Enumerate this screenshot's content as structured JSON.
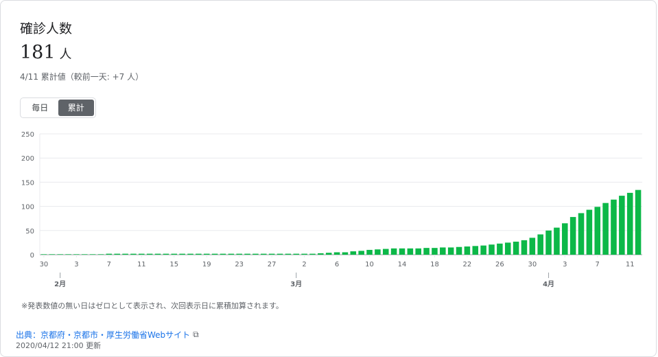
{
  "header": {
    "title": "確診人数",
    "total_value": "181",
    "total_unit": "人",
    "subtitle": "4/11 累計値（較前一天: +7 人）"
  },
  "toggle": {
    "daily_label": "毎日",
    "cumulative_label": "累計",
    "selected": "累計"
  },
  "colors": {
    "bar": "#0cb848",
    "grid": "#e8eaed",
    "axis": "#9aa0a6"
  },
  "chart_data": {
    "type": "bar",
    "title": "",
    "xlabel": "",
    "ylabel": "",
    "ylim": [
      0,
      250
    ],
    "yticks": [
      0,
      50,
      100,
      150,
      200,
      250
    ],
    "grid": true,
    "x_tick_labels": [
      "30",
      "3",
      "7",
      "11",
      "15",
      "19",
      "23",
      "27",
      "2",
      "6",
      "10",
      "14",
      "18",
      "22",
      "26",
      "30",
      "3",
      "7",
      "11"
    ],
    "month_labels": [
      "2月",
      "3月",
      "4月"
    ],
    "categories": [
      "1/30",
      "1/31",
      "2/1",
      "2/2",
      "2/3",
      "2/4",
      "2/5",
      "2/6",
      "2/7",
      "2/8",
      "2/9",
      "2/10",
      "2/11",
      "2/12",
      "2/13",
      "2/14",
      "2/15",
      "2/16",
      "2/17",
      "2/18",
      "2/19",
      "2/20",
      "2/21",
      "2/22",
      "2/23",
      "2/24",
      "2/25",
      "2/26",
      "2/27",
      "2/28",
      "2/29",
      "3/1",
      "3/2",
      "3/3",
      "3/4",
      "3/5",
      "3/6",
      "3/7",
      "3/8",
      "3/9",
      "3/10",
      "3/11",
      "3/12",
      "3/13",
      "3/14",
      "3/15",
      "3/16",
      "3/17",
      "3/18",
      "3/19",
      "3/20",
      "3/21",
      "3/22",
      "3/23",
      "3/24",
      "3/25",
      "3/26",
      "3/27",
      "3/28",
      "3/29",
      "3/30",
      "3/31",
      "4/1",
      "4/2",
      "4/3",
      "4/4",
      "4/5",
      "4/6",
      "4/7",
      "4/8",
      "4/9",
      "4/10",
      "4/11"
    ],
    "values": [
      1,
      1,
      1,
      1,
      1,
      1,
      1,
      1,
      2,
      2,
      2,
      2,
      2,
      2,
      2,
      2,
      2,
      2,
      2,
      2,
      2,
      2,
      2,
      2,
      2,
      2,
      2,
      2,
      2,
      2,
      2,
      2,
      2,
      2,
      3,
      4,
      5,
      5,
      7,
      8,
      10,
      11,
      12,
      13,
      13,
      13,
      13,
      14,
      14,
      15,
      15,
      16,
      17,
      18,
      19,
      21,
      23,
      25,
      27,
      30,
      35,
      42,
      50,
      56,
      65,
      78,
      86,
      93,
      99,
      107,
      114,
      122,
      128,
      134
    ]
  },
  "footer": {
    "note": "※発表数値の無い日はゼロとして表示され、次回表示日に累積加算されます。",
    "source_label": "出典：京都府・京都市・厚生労働省Webサイト",
    "updated": "2020/04/12 21:00 更新"
  }
}
